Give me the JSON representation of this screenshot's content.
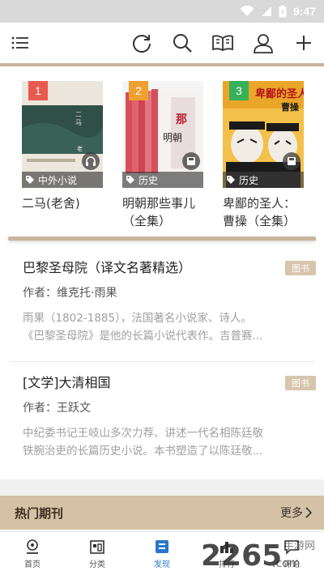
{
  "status_bar": {
    "time": "9:47"
  },
  "toolbar": {
    "icons": [
      "menu-icon",
      "refresh-icon",
      "search-icon",
      "book-icon",
      "user-icon",
      "add-icon"
    ]
  },
  "featured_books": [
    {
      "rank": "1",
      "rank_color": "#e85a4f",
      "tag": "中外小说",
      "title_lines": [
        "二马(老舍)"
      ],
      "has_audio": true
    },
    {
      "rank": "2",
      "rank_color": "#f0a030",
      "tag": "历史",
      "title_lines": [
        "明朝那些事儿",
        "（全集）"
      ],
      "has_audio": false
    },
    {
      "rank": "3",
      "rank_color": "#37b05a",
      "tag": "历史",
      "title_lines": [
        "卑鄙的圣人：",
        "曹操（全集）"
      ],
      "has_audio": false
    }
  ],
  "list": [
    {
      "title": "巴黎圣母院（译文名著精选）",
      "badge": "图书",
      "author": "作者：维克托·雨果",
      "desc_lines": [
        "雨果（1802-1885），法国著名小说家、诗人。",
        "《巴黎圣母院》是他的长篇小说代表作。吉普赛..."
      ]
    },
    {
      "title": "[文学]大清相国",
      "badge": "图书",
      "author": "作者：王跃文",
      "desc_lines": [
        "中纪委书记王岐山多次力荐、讲述一代名相陈廷敬",
        "铁腕治吏的长篇历史小说。本书塑造了以陈廷敬..."
      ]
    }
  ],
  "section": {
    "title": "热门期刊",
    "more": "更多"
  },
  "bottom_nav": [
    {
      "label": "首页",
      "icon": "home-icon",
      "active": false
    },
    {
      "label": "分类",
      "icon": "category-icon",
      "active": false
    },
    {
      "label": "发现",
      "icon": "discover-icon",
      "active": true
    },
    {
      "label": "排行",
      "icon": "ranking-icon",
      "active": false
    },
    {
      "label": "评论",
      "icon": "comment-icon",
      "active": false
    }
  ],
  "watermark": {
    "brand": "2265",
    "domain": ".com",
    "site": "手游网"
  },
  "colors": {
    "accent": "#c9b49c",
    "nav_active": "#2a77c9",
    "badge": "#d7c5ad"
  }
}
